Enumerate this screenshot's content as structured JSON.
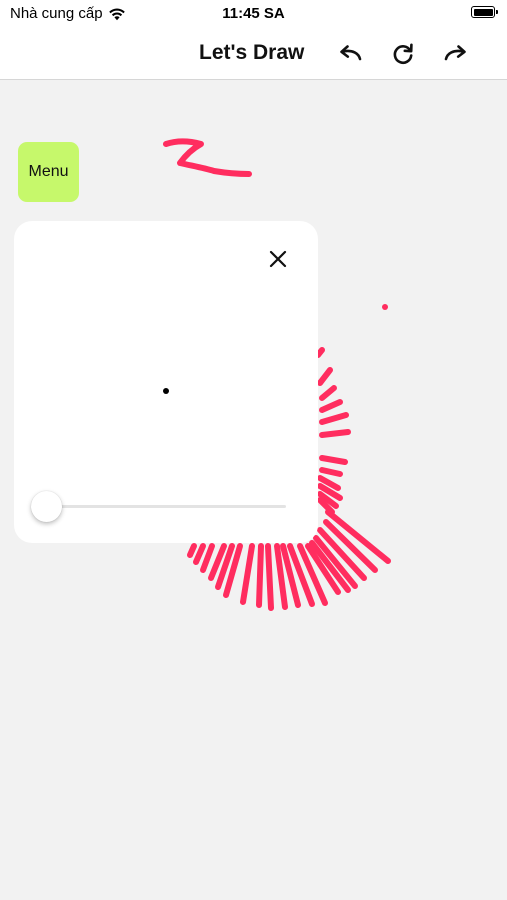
{
  "status_bar": {
    "carrier": "Nhà cung cấp",
    "time": "11:45 SA",
    "battery_level": 1.0
  },
  "nav": {
    "title": "Let's Draw",
    "icons": [
      "undo-icon",
      "refresh-icon",
      "redo-icon"
    ]
  },
  "menu": {
    "label": "Menu"
  },
  "brush_panel": {
    "close_icon": "close-icon",
    "size_slider_value": 0.0
  },
  "colors": {
    "menu_button": "#c6f86b",
    "stroke": "#ff2d5f",
    "canvas_background": "#f2f2f2"
  }
}
